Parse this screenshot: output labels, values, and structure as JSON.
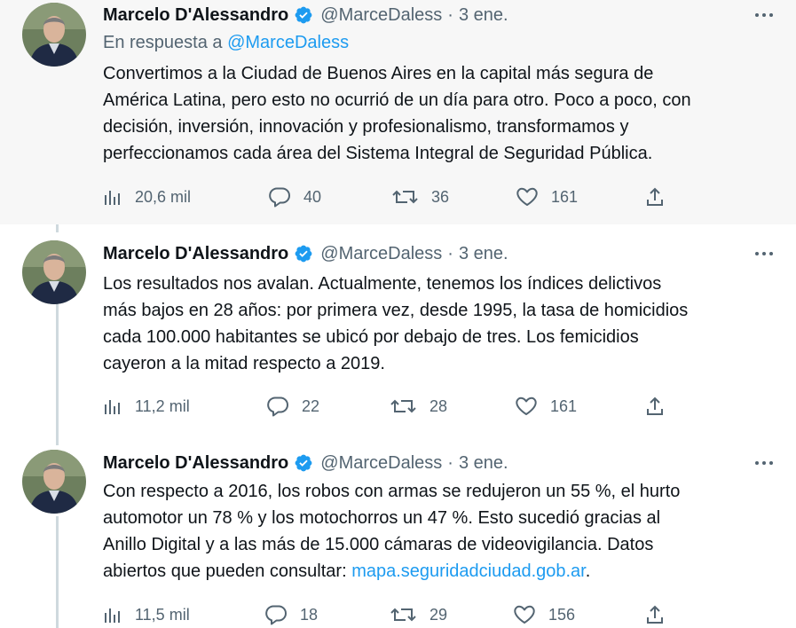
{
  "tweets": [
    {
      "author": "Marcelo D'Alessandro",
      "handle": "@MarceDaless",
      "separator": "·",
      "time": "3 ene.",
      "reply_prefix": "En respuesta a ",
      "reply_handle": "@MarceDaless",
      "text": "Convertimos a la Ciudad de Buenos Aires en la capital más segura de\nAmérica Latina, pero esto no ocurrió de un día para otro. Poco a poco, con\ndecisión, inversión, innovación y profesionalismo, transformamos y\nperfeccionamos cada área del Sistema Integral de Seguridad Pública.",
      "views": "20,6 mil",
      "replies": "40",
      "retweets": "36",
      "likes": "161"
    },
    {
      "author": "Marcelo D'Alessandro",
      "handle": "@MarceDaless",
      "separator": "·",
      "time": "3 ene.",
      "text": "Los resultados nos avalan. Actualmente, tenemos los índices delictivos\nmás bajos en 28 años: por primera vez, desde 1995, la tasa de homicidios\ncada 100.000 habitantes se ubicó por debajo de tres. Los femicidios\ncayeron a la mitad respecto a 2019.",
      "views": "11,2 mil",
      "replies": "22",
      "retweets": "28",
      "likes": "161"
    },
    {
      "author": "Marcelo D'Alessandro",
      "handle": "@MarceDaless",
      "separator": "·",
      "time": "3 ene.",
      "text": "Con respecto a 2016, los robos con armas se redujeron un 55 %, el hurto\nautomotor un 78 % y los motochorros un 47 %. Esto sucedió gracias al\nAnillo Digital y a las más de 15.000 cámaras de videovigilancia. Datos\nabiertos que pueden consultar: ",
      "link": "mapa.seguridadciudad.gob.ar",
      "text_suffix": ".",
      "views": "11,5 mil",
      "replies": "18",
      "retweets": "29",
      "likes": "156"
    }
  ],
  "colors": {
    "accent": "#1d9bf0",
    "secondary_text": "#536471",
    "thread_line": "#cfd9de",
    "highlight_bg": "#f7f7f7"
  },
  "icons": {
    "views": "bar-chart-icon",
    "reply": "speech-bubble-icon",
    "retweet": "retweet-icon",
    "like": "heart-icon",
    "share": "share-upload-icon",
    "verified": "verified-badge-icon",
    "more": "more-dots-icon"
  }
}
